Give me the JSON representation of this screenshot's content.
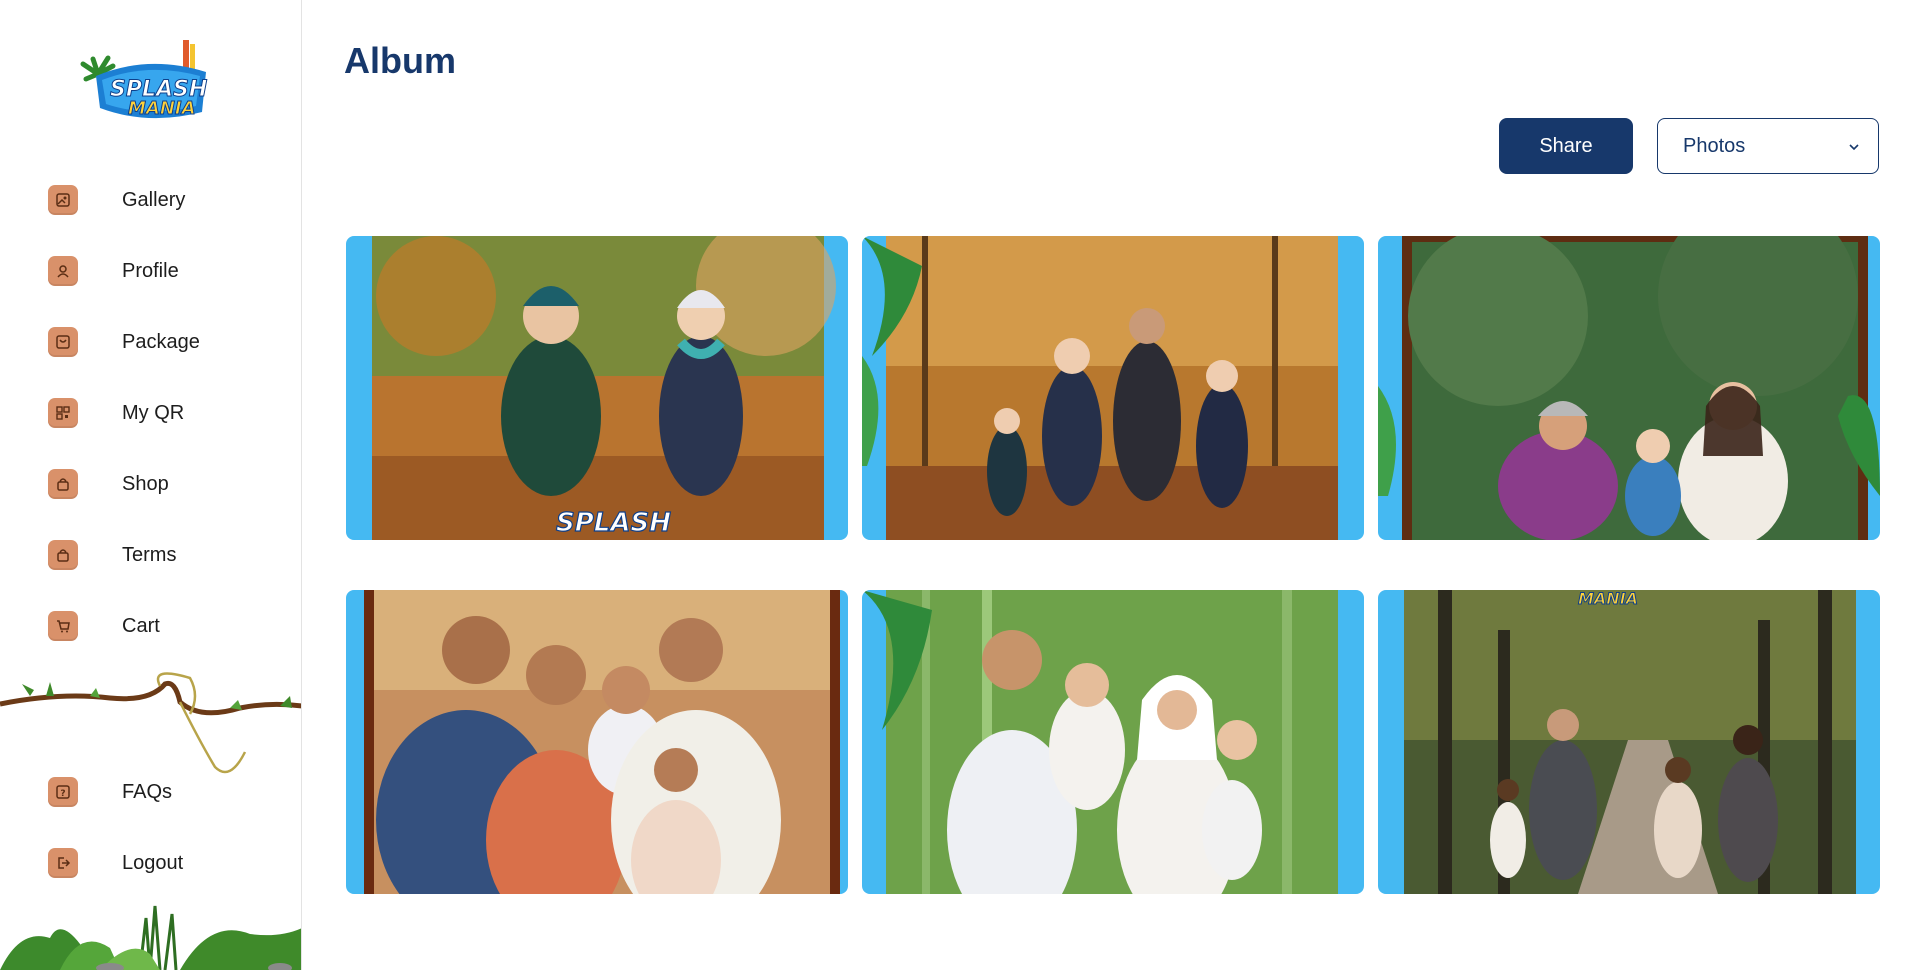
{
  "brand": {
    "logo_name": "Splash Mania Gamuda Cove"
  },
  "sidebar": {
    "items": [
      {
        "label": "Gallery",
        "icon": "gallery-icon"
      },
      {
        "label": "Profile",
        "icon": "profile-icon"
      },
      {
        "label": "Package",
        "icon": "package-icon"
      },
      {
        "label": "My QR",
        "icon": "qr-icon"
      },
      {
        "label": "Shop",
        "icon": "shop-icon"
      },
      {
        "label": "Terms",
        "icon": "terms-icon"
      },
      {
        "label": "Cart",
        "icon": "cart-icon"
      }
    ],
    "bottom_items": [
      {
        "label": "FAQs",
        "icon": "faq-icon"
      },
      {
        "label": "Logout",
        "icon": "logout-icon"
      }
    ]
  },
  "main": {
    "title": "Album",
    "share_label": "Share",
    "filter": {
      "selected": "Photos"
    },
    "photos": [
      {
        "scene": "two children running in autumn forest",
        "frame": "blue"
      },
      {
        "scene": "family of four walking on autumn path",
        "frame": "palm"
      },
      {
        "scene": "family with toddler in green forest",
        "frame": "wood"
      },
      {
        "scene": "family group hug portrait",
        "frame": "wood"
      },
      {
        "scene": "family in bamboo forest",
        "frame": "palm"
      },
      {
        "scene": "family walking away down tree-lined path",
        "frame": "blue"
      }
    ]
  },
  "colors": {
    "accent": "#17386b",
    "icon_tile": "#d9916a",
    "frame_blue": "#45b9f2"
  }
}
